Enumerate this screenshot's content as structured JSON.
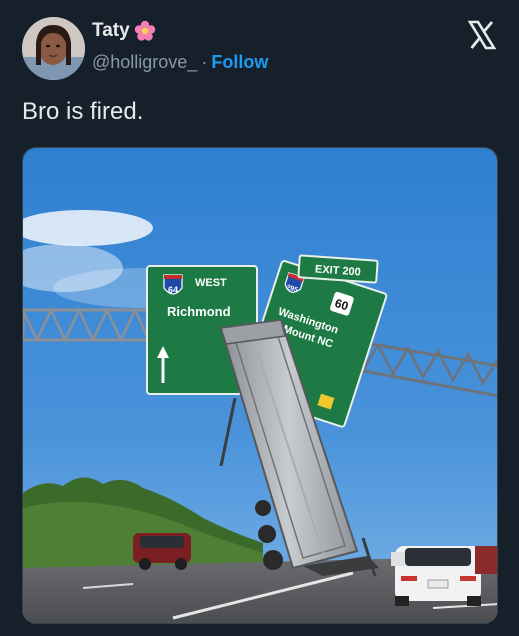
{
  "author": {
    "display_name": "Taty",
    "display_name_emoji": "flower-icon",
    "handle": "@holligrove_",
    "separator": "·",
    "follow_label": "Follow"
  },
  "header": {
    "platform_icon": "x-logo-icon"
  },
  "tweet": {
    "text": "Bro is fired."
  },
  "media": {
    "signs": {
      "interstate_64": "64",
      "west": "WEST",
      "richmond": "Richmond",
      "exit": "EXIT 200",
      "interstate_295": "295",
      "us_60": "60",
      "washington": "Washington",
      "mount_nc": "Mount NC"
    }
  },
  "colors": {
    "background": "#15202b",
    "text": "#e7e9ea",
    "muted": "#8b98a5",
    "accent": "#1d9bf0",
    "sign_green": "#1d7a44"
  }
}
